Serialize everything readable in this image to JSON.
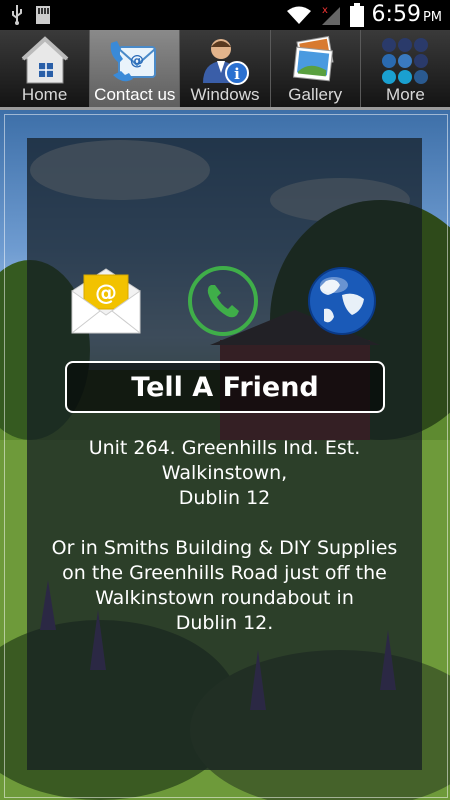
{
  "status_bar": {
    "time": "6:59",
    "ampm": "PM"
  },
  "tabs": [
    {
      "label": "Home",
      "icon": "home-icon",
      "active": false
    },
    {
      "label": "Contact us",
      "icon": "contact-icon",
      "active": true
    },
    {
      "label": "Windows",
      "icon": "person-info-icon",
      "active": false
    },
    {
      "label": "Gallery",
      "icon": "gallery-icon",
      "active": false
    },
    {
      "label": "More",
      "icon": "more-grid-icon",
      "active": false
    }
  ],
  "contact": {
    "tell_friend": "Tell A Friend",
    "address_lines": [
      "Unit 264. Greenhills Ind. Est.",
      "Walkinstown,",
      "Dublin 12"
    ],
    "directions_lines": [
      "Or in Smiths Building & DIY Supplies",
      "on the Greenhills Road just off the",
      "Walkinstown roundabout in",
      "Dublin 12."
    ]
  },
  "colors": {
    "phone_green": "#3fae49",
    "envelope_yellow": "#f2c200"
  }
}
